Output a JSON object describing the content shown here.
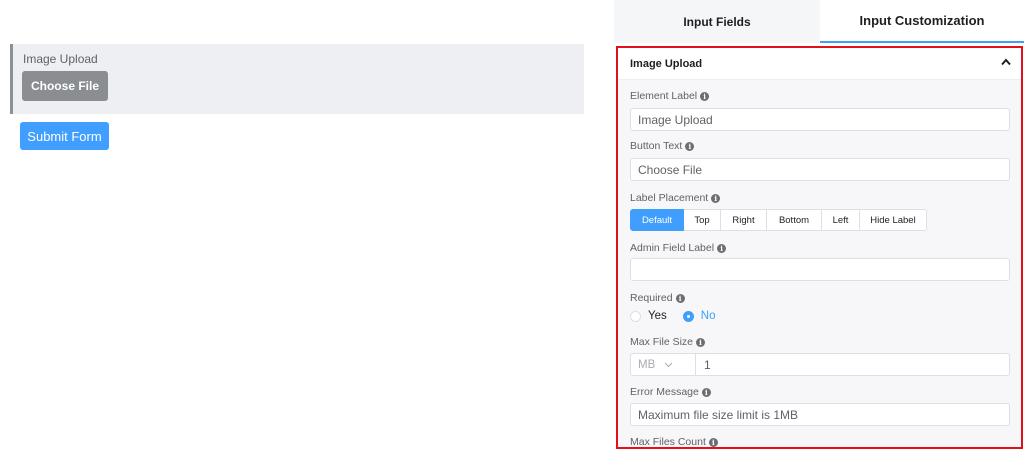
{
  "preview": {
    "field_label": "Image Upload",
    "choose_button": "Choose File",
    "submit_button": "Submit Form"
  },
  "tabs": [
    {
      "label": "Input Fields"
    },
    {
      "label": "Input Customization"
    }
  ],
  "section": {
    "title": "Image Upload",
    "collapse_icon": "chevron-up-icon"
  },
  "fields": {
    "element_label": {
      "label": "Element Label",
      "value": "Image Upload"
    },
    "button_text": {
      "label": "Button Text",
      "value": "Choose File"
    },
    "label_placement": {
      "label": "Label Placement",
      "options": [
        "Default",
        "Top",
        "Right",
        "Bottom",
        "Left",
        "Hide Label"
      ],
      "selected": "Default"
    },
    "admin_field_label": {
      "label": "Admin Field Label",
      "value": ""
    },
    "required": {
      "label": "Required",
      "yes": "Yes",
      "no": "No",
      "selected": "No"
    },
    "max_file_size": {
      "label": "Max File Size",
      "unit": "MB",
      "value": "1"
    },
    "error_message": {
      "label": "Error Message",
      "value": "Maximum file size limit is 1MB"
    },
    "max_files_count": {
      "label": "Max Files Count"
    }
  },
  "colors": {
    "accent": "#409eff",
    "highlight_border": "#e0111b",
    "preview_button": "#8a8d91"
  }
}
